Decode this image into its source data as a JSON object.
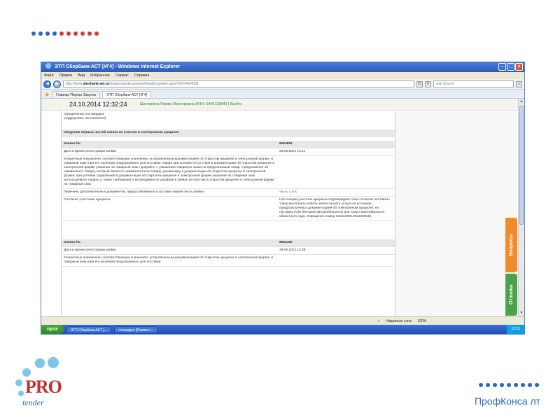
{
  "window": {
    "title": "ЭТП Сбербанк-АСТ [#Г4] - Windows Internet Explorer",
    "menu": [
      "Файл",
      "Правка",
      "Вид",
      "Избранное",
      "Сервис",
      "Справка"
    ],
    "url_prefix": "http://www.",
    "url_host": "sberbank-ast.ru",
    "url_rest": "/tradezone/documents/viewDocument.aspx?id=24404038",
    "search_placeholder": "Ask Search",
    "tabs": [
      "Главная Портал Закупок",
      "ЭТП Сбербанк-АСТ [#Г4]"
    ]
  },
  "header": {
    "datetime": "24.10.2014 12:32:24",
    "user": "Шатовкина Римма Викторовна ИНН: 5406118840 | Выйти"
  },
  "content": {
    "intro": [
      "определении поставщика",
      "(подрядчика, исполнителя)"
    ],
    "section_title": "Сведения первых частей заявок на участие в электронном аукционе",
    "block1": {
      "num_label": "Заявка №:",
      "num_value": "8664884",
      "date_label": "Дата и время регистрации заявки",
      "date_value": "29.08.2014 13:11",
      "indicators": "Конкретные показатели, соответствующие значениям, установленным документацией об открытом аукционе в электронной форме, и товарный знак (при его наличии) предлагаемого для поставки товара при условии отсутствия в документации об открытом аукционе в электронной форме указания на товарный знак / документ с указанием товарного знака на предлагаемый товар / предложение об эквиваленте товара, который является эквивалентным товару, указанному в документации об открытом аукционе в электронной форме, при условии содержания в документации об открытом аукционе в электронной форме указания на товарный знак используемого товара, а также требования о необходимости указания в заявке на участие в открытом аукционе в электронной форме на товарный знак",
      "docs_label": "Перечень дополнительных документов, предоставляемых в составе первой части заявки",
      "docs_value": "часть 1.doc",
      "consent_label": "Согласие участника аукциона",
      "consent_value": "Настоящим участник аукциона подтверждает свое согласие поставить товар,выполнить работы и/или оказать услуги на условиях, предусмотренных документацией об электронном аукционе: на поставку ГСМ (бензина автомобильного) для нужд Новосибирского областного суда. Извещение номер 0151100014914000043."
    },
    "block2": {
      "num_label": "Заявка №:",
      "num_value": "8664480",
      "date_label": "Дата и время регистрации заявки",
      "date_value": "29.08.2014 13:38",
      "indicators": "Конкретные показатели, соответствующие значениям, установленным документацией об открытом аукционе в электронной форме, и товарный знак (при его наличии) предлагаемого для поставки"
    }
  },
  "side_tabs": {
    "questions": "Вопросы",
    "reviews": "Отзывы"
  },
  "statusbar": {
    "zone": "Надежные узлы",
    "zoom": "100%"
  },
  "taskbar": {
    "start": "пуск",
    "items": [
      "ЭТП Сбербанк-АСТ [...",
      "площадка [Режим с..."
    ],
    "clock": "12:32"
  },
  "slide": {
    "logo_main": "PRO",
    "logo_sub": "tender",
    "brand": "ПрофКонса лт"
  }
}
